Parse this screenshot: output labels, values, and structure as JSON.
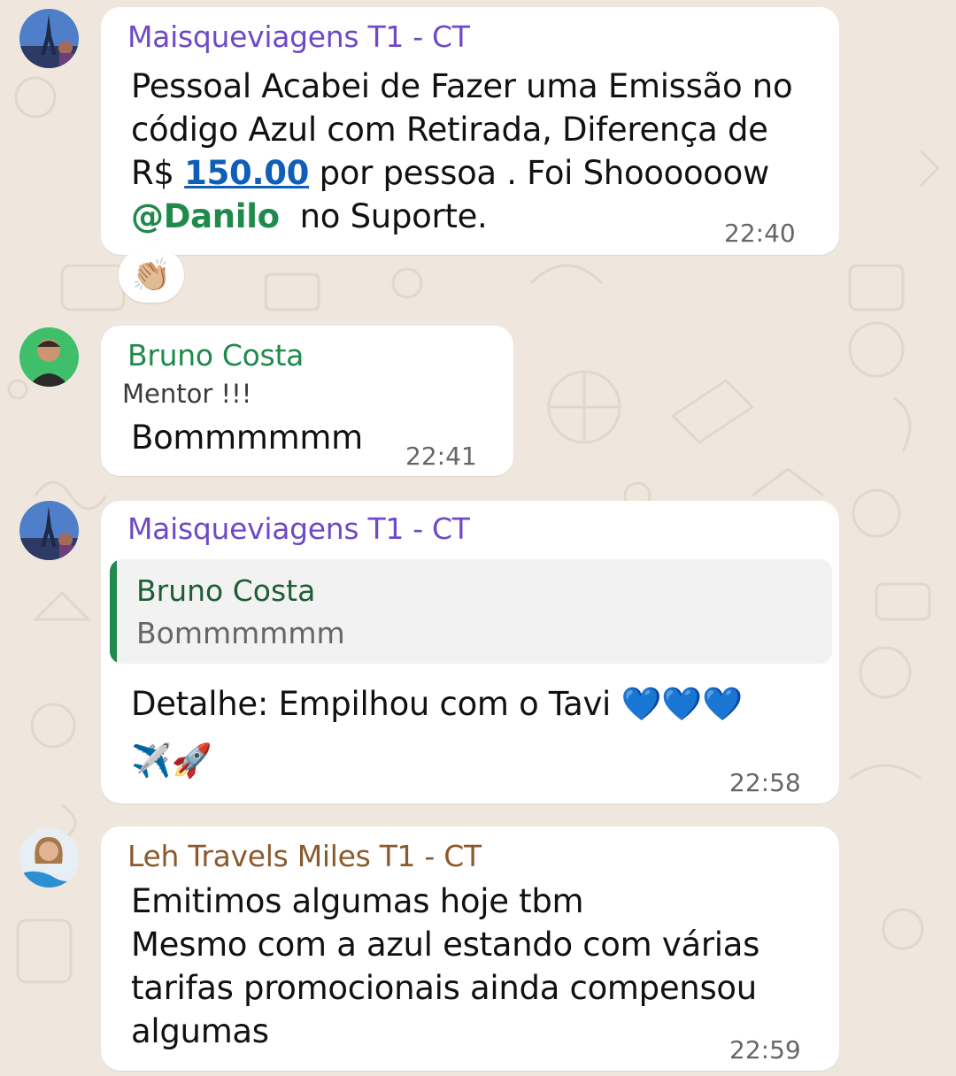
{
  "messages": [
    {
      "sender": "Maisqueviagens T1 - CT",
      "text_line1": "Pessoal Acabei de Fazer uma Emissão no",
      "text_line2": "código Azul com Retirada, Diferença de",
      "text_line3_prefix": "R$",
      "text_line3_link": "150.00",
      "text_line3_suffix": "por pessoa . Foi Shoooooow",
      "mention": "@Danilo",
      "text_line4_suffix": "no Suporte.",
      "time": "22:40",
      "reaction": "👏🏼",
      "avatar_icon": "eiffel-tower-photo"
    },
    {
      "sender": "Bruno Costa",
      "role": "Mentor !!!",
      "text": "Bommmmmm",
      "time": "22:41",
      "avatar_icon": "man-portrait-photo"
    },
    {
      "sender": "Maisqueviagens T1 - CT",
      "quote_sender": "Bruno Costa",
      "quote_text": "Bommmmmm",
      "text_line1": "Detalhe: Empilhou com o Tavi 💙💙💙",
      "text_line2": "✈️🚀",
      "time": "22:58",
      "avatar_icon": "eiffel-tower-photo"
    },
    {
      "sender": "Leh Travels Miles T1 - CT",
      "text_line1": "Emitimos algumas hoje tbm",
      "text_line2": "Mesmo com a azul estando com várias",
      "text_line3": "tarifas promocionais ainda compensou",
      "text_line4": "algumas",
      "time": "22:59",
      "avatar_icon": "woman-portrait-photo"
    }
  ],
  "colors": {
    "background": "#efe7dd",
    "bubble": "#ffffff",
    "sender_purple": "#6f49c8",
    "sender_green": "#1f8a4c",
    "sender_brown": "#8a5a2c",
    "link": "#0f5fb8",
    "quote_bar": "#1f8a4c"
  }
}
